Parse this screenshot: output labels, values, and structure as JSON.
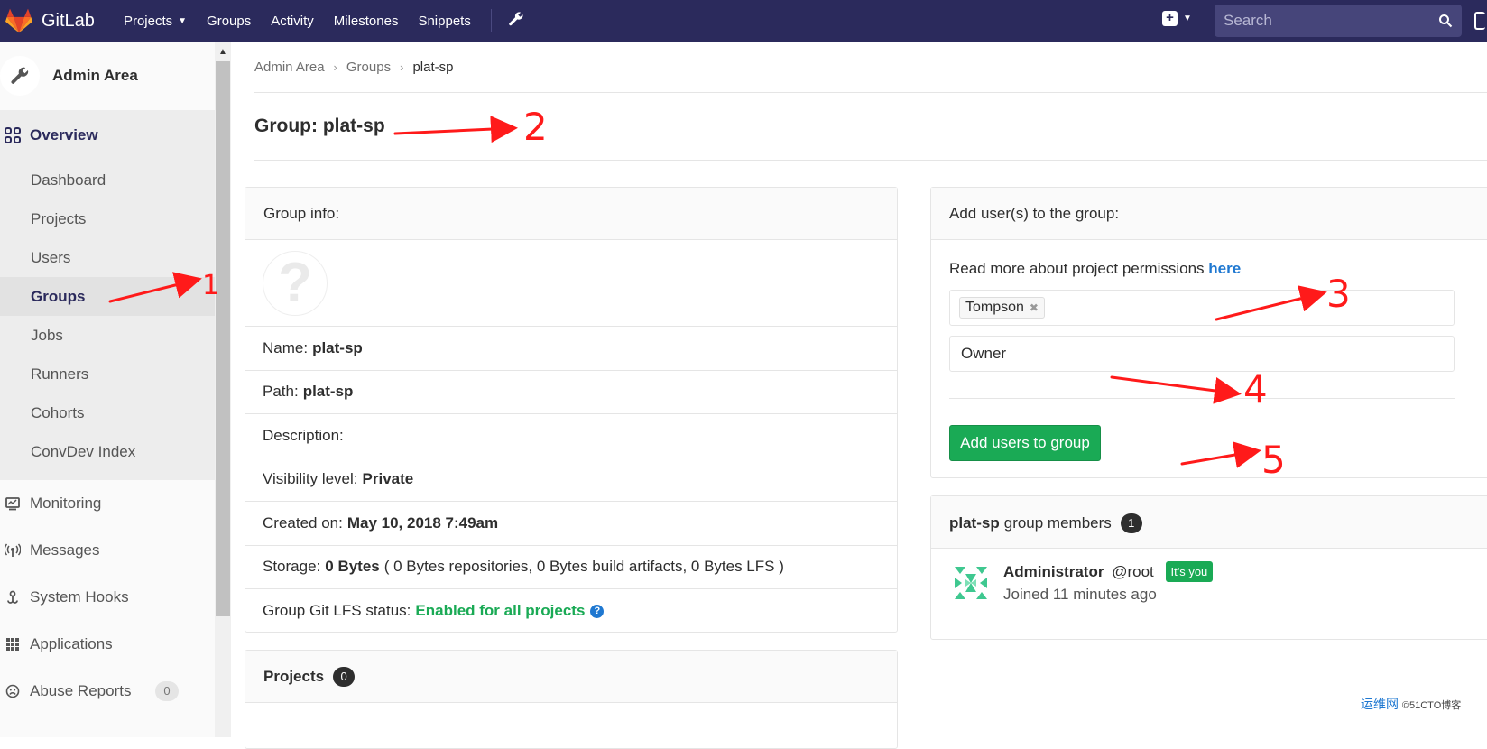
{
  "navbar": {
    "brand": "GitLab",
    "links": [
      {
        "label": "Projects",
        "has_caret": true
      },
      {
        "label": "Groups"
      },
      {
        "label": "Activity"
      },
      {
        "label": "Milestones"
      },
      {
        "label": "Snippets"
      }
    ],
    "search_placeholder": "Search"
  },
  "sidebar": {
    "title": "Admin Area",
    "overview_label": "Overview",
    "overview_items": [
      "Dashboard",
      "Projects",
      "Users",
      "Groups",
      "Jobs",
      "Runners",
      "Cohorts",
      "ConvDev Index"
    ],
    "active_item": "Groups",
    "items": [
      {
        "label": "Monitoring",
        "icon": "monitor-icon"
      },
      {
        "label": "Messages",
        "icon": "broadcast-icon"
      },
      {
        "label": "System Hooks",
        "icon": "hook-icon"
      },
      {
        "label": "Applications",
        "icon": "grid-icon"
      },
      {
        "label": "Abuse Reports",
        "icon": "flag-icon",
        "badge": "0"
      }
    ]
  },
  "breadcrumb": [
    "Admin Area",
    "Groups",
    "plat-sp"
  ],
  "page_title": "Group: plat-sp",
  "group_info": {
    "header": "Group info:",
    "name_label": "Name:",
    "name": "plat-sp",
    "path_label": "Path:",
    "path": "plat-sp",
    "description_label": "Description:",
    "visibility_label": "Visibility level:",
    "visibility": "Private",
    "created_label": "Created on:",
    "created": "May 10, 2018 7:49am",
    "storage_label": "Storage:",
    "storage": "0 Bytes",
    "storage_detail": "( 0 Bytes repositories, 0 Bytes build artifacts, 0 Bytes LFS )",
    "lfs_label": "Group Git LFS status:",
    "lfs_status": "Enabled for all projects"
  },
  "projects_panel": {
    "header": "Projects",
    "count": "0"
  },
  "add_users": {
    "header": "Add user(s) to the group:",
    "permissions_text": "Read more about project permissions",
    "permissions_link": "here",
    "selected_user": "Tompson",
    "access_level": "Owner",
    "submit_label": "Add users to group"
  },
  "members": {
    "group": "plat-sp",
    "header_suffix": "group members",
    "count": "1",
    "list": [
      {
        "name": "Administrator",
        "handle": "@root",
        "badge": "It's you",
        "joined": "Joined 11 minutes ago"
      }
    ]
  },
  "annotations": [
    "1",
    "2",
    "3",
    "4",
    "5"
  ],
  "watermark": {
    "brand": "运维网",
    "sub": "©51CTO博客"
  },
  "colors": {
    "navbar": "#2b2a5c",
    "accent_green": "#1aaa55",
    "link_blue": "#1f78d1",
    "annotation_red": "#ff1a1a"
  }
}
